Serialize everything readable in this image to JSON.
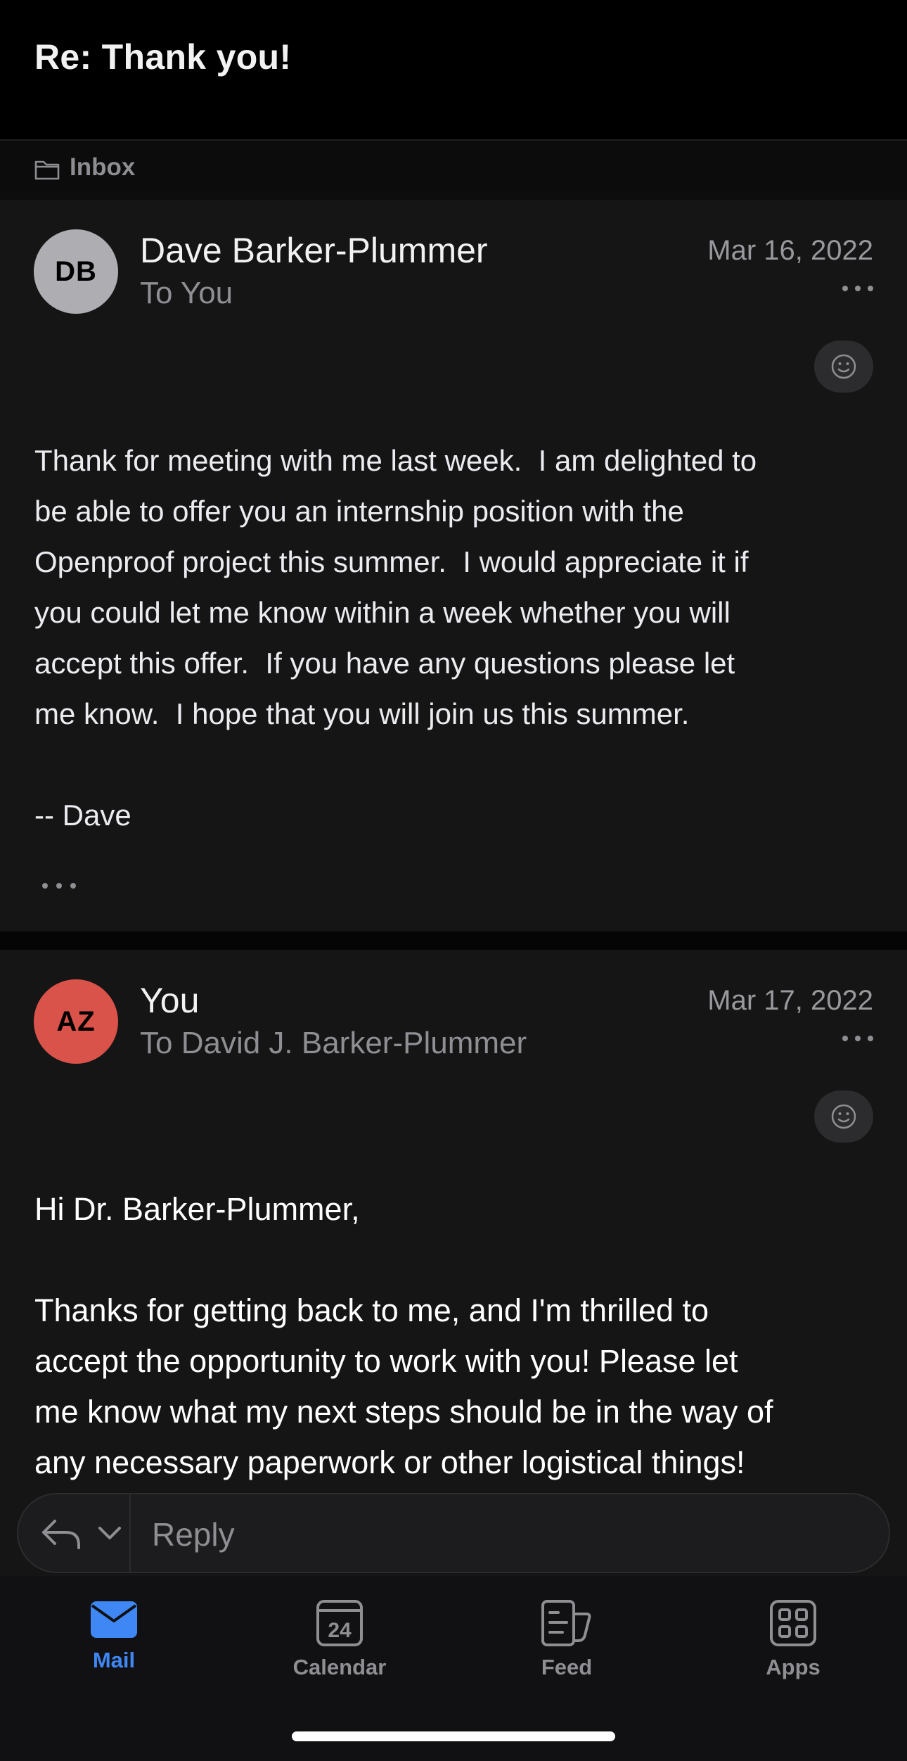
{
  "header": {
    "subject": "Re: Thank you!"
  },
  "folder": {
    "label": "Inbox",
    "icon": "folder-icon"
  },
  "messages": [
    {
      "avatar_initials": "DB",
      "avatar_color": "#aeaeb2",
      "avatar_text_color": "#000000",
      "sender": "Dave Barker-Plummer",
      "recipient": "To You",
      "date": "Mar 16, 2022",
      "body": "Thank for meeting with me last week.  I am delighted to\nbe able to offer you an internship position with the\nOpenproof project this summer.  I would appreciate it if\nyou could let me know within a week whether you will\naccept this offer.  If you have any questions please let\nme know.  I hope that you will join us this summer.\n\n-- Dave"
    },
    {
      "avatar_initials": "AZ",
      "avatar_color": "#d9534a",
      "avatar_text_color": "#000000",
      "sender": "You",
      "recipient": "To David J. Barker-Plummer",
      "date": "Mar 17, 2022",
      "body": "Hi Dr. Barker-Plummer,\n\nThanks for getting back to me, and I'm thrilled to\naccept the opportunity to work with you! Please let\nme know what my next steps should be in the way of\nany necessary paperwork or other logistical things!"
    }
  ],
  "reply": {
    "label": "Reply"
  },
  "tabs": [
    {
      "label": "Mail",
      "icon": "mail-icon",
      "active": true
    },
    {
      "label": "Calendar",
      "icon": "calendar-icon",
      "day": "24"
    },
    {
      "label": "Feed",
      "icon": "feed-icon"
    },
    {
      "label": "Apps",
      "icon": "apps-icon"
    }
  ],
  "colors": {
    "accent": "#3f87f5",
    "background": "#151516",
    "header": "#000000"
  }
}
